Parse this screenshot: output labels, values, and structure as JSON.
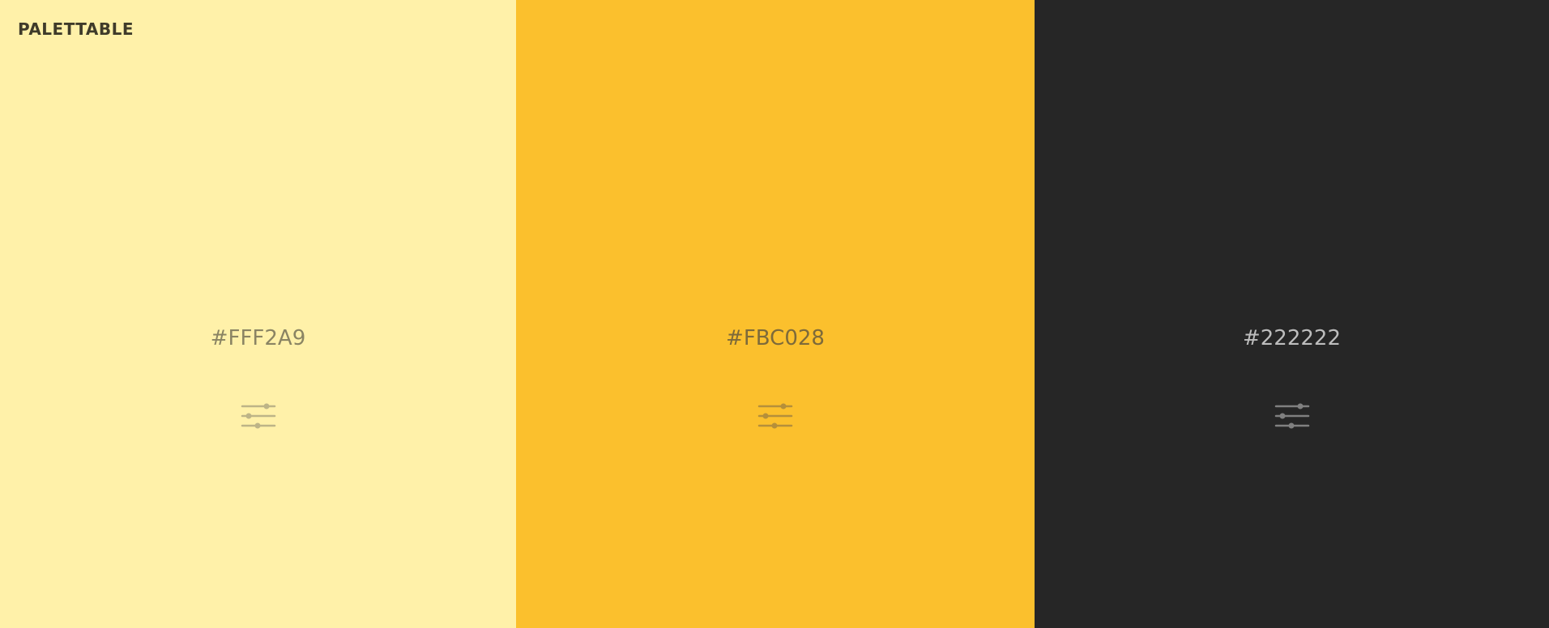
{
  "app": {
    "logo": "PALETTABLE"
  },
  "palette": {
    "swatches": [
      {
        "hex": "#FFF2A9",
        "color": "#FFF1A9",
        "text_color": "#8a8463",
        "icon_color": "#bdb487",
        "icon": "sliders-icon"
      },
      {
        "hex": "#FBC028",
        "color": "#FBC02D",
        "text_color": "#7d6a3a",
        "icon_color": "#b58f3a",
        "icon": "sliders-icon"
      },
      {
        "hex": "#222222",
        "color": "#262626",
        "text_color": "#bdbdbd",
        "icon_color": "#808080",
        "icon": "sliders-icon"
      }
    ]
  }
}
